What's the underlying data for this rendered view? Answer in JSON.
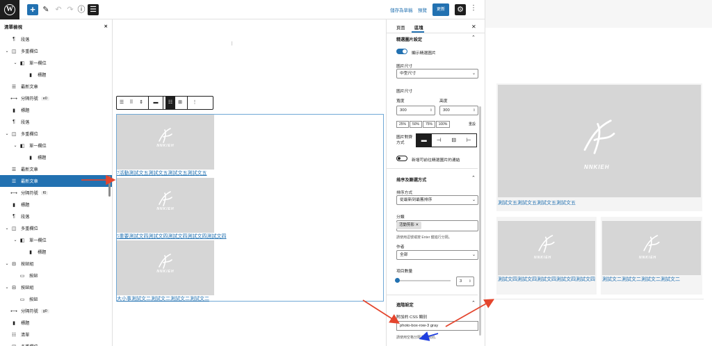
{
  "toolbar": {
    "save_draft_label": "儲存為草稿",
    "preview_label": "預覽",
    "update_label": "更新"
  },
  "listview": {
    "title": "清單檢視",
    "items": [
      {
        "label": "段落",
        "icon": "paragraph-icon",
        "glyph": "¶",
        "depth": 0,
        "chev": ""
      },
      {
        "label": "多重欄位",
        "icon": "columns-icon",
        "glyph": "◫",
        "depth": 0,
        "chev": "⌄"
      },
      {
        "label": "單一欄位",
        "icon": "column-icon",
        "glyph": "◧",
        "depth": 1,
        "chev": "⌄"
      },
      {
        "label": "標題",
        "icon": "bookmark-icon",
        "glyph": "▮",
        "depth": 2,
        "chev": ""
      },
      {
        "label": "最新文章",
        "icon": "post-list-icon",
        "glyph": "☰",
        "depth": 0,
        "chev": ""
      },
      {
        "label": "分隔符號",
        "icon": "separator-icon",
        "glyph": "⟷",
        "depth": 0,
        "chev": "",
        "badge": "e0"
      },
      {
        "label": "標題",
        "icon": "bookmark-icon",
        "glyph": "▮",
        "depth": 0,
        "chev": ""
      },
      {
        "label": "段落",
        "icon": "paragraph-icon",
        "glyph": "¶",
        "depth": 0,
        "chev": ""
      },
      {
        "label": "多重欄位",
        "icon": "columns-icon",
        "glyph": "◫",
        "depth": 0,
        "chev": "⌄"
      },
      {
        "label": "單一欄位",
        "icon": "column-icon",
        "glyph": "◧",
        "depth": 1,
        "chev": "⌄"
      },
      {
        "label": "標題",
        "icon": "bookmark-icon",
        "glyph": "▮",
        "depth": 2,
        "chev": ""
      },
      {
        "label": "最新文章",
        "icon": "post-list-icon",
        "glyph": "☰",
        "depth": 0,
        "chev": ""
      },
      {
        "label": "最新文章",
        "icon": "post-list-icon",
        "glyph": "☰",
        "depth": 0,
        "chev": "",
        "active": true
      },
      {
        "label": "分隔符號",
        "icon": "separator-icon",
        "glyph": "⟷",
        "depth": 0,
        "chev": "",
        "badge": "f0"
      },
      {
        "label": "標題",
        "icon": "bookmark-icon",
        "glyph": "▮",
        "depth": 0,
        "chev": ""
      },
      {
        "label": "段落",
        "icon": "paragraph-icon",
        "glyph": "¶",
        "depth": 0,
        "chev": ""
      },
      {
        "label": "多重欄位",
        "icon": "columns-icon",
        "glyph": "◫",
        "depth": 0,
        "chev": "⌄"
      },
      {
        "label": "單一欄位",
        "icon": "column-icon",
        "glyph": "◧",
        "depth": 1,
        "chev": "⌄"
      },
      {
        "label": "標題",
        "icon": "bookmark-icon",
        "glyph": "▮",
        "depth": 2,
        "chev": ""
      },
      {
        "label": "按鈕組",
        "icon": "buttons-icon",
        "glyph": "⊟",
        "depth": 0,
        "chev": "⌄"
      },
      {
        "label": "按鈕",
        "icon": "button-icon",
        "glyph": "▭",
        "depth": 1,
        "chev": ""
      },
      {
        "label": "按鈕組",
        "icon": "buttons-icon",
        "glyph": "⊟",
        "depth": 0,
        "chev": "⌄"
      },
      {
        "label": "按鈕",
        "icon": "button-icon",
        "glyph": "▭",
        "depth": 1,
        "chev": ""
      },
      {
        "label": "分隔符號",
        "icon": "separator-icon",
        "glyph": "⟷",
        "depth": 0,
        "chev": "",
        "badge": "g0"
      },
      {
        "label": "標題",
        "icon": "bookmark-icon",
        "glyph": "▮",
        "depth": 0,
        "chev": ""
      },
      {
        "label": "清單",
        "icon": "list-icon",
        "glyph": "☷",
        "depth": 0,
        "chev": ""
      },
      {
        "label": "多重欄位",
        "icon": "columns-icon",
        "glyph": "◫",
        "depth": 0,
        "chev": "⌄"
      }
    ]
  },
  "canvas": {
    "posts": [
      {
        "title": "7活動測試文五測試文五測試文五測試文五",
        "logo_text": "NNKIEH"
      },
      {
        "title": "5重要測試文四測試文四測試文四測試文四測試文四",
        "logo_text": "NNKIEH"
      },
      {
        "title": "大小事測試文二測試文二測試文二測試文二",
        "logo_text": "NNKIEH"
      }
    ]
  },
  "sidebar": {
    "tab_page": "頁面",
    "tab_block": "區塊",
    "featured_section": "精選圖片設定",
    "show_featured": "顯示精選圖片",
    "image_size_label": "圖片尺寸",
    "image_size_value": "中型尺寸",
    "image_dims_label": "圖片尺寸",
    "width_label": "寬度",
    "height_label": "高度",
    "width_value": "300",
    "height_value": "300",
    "pct": [
      "25%",
      "50%",
      "75%",
      "100%"
    ],
    "reset_label": "重設",
    "align_label": "圖片對齊方式",
    "link_label": "新增可前往精選圖片的連結",
    "sort_section": "排序及篩選方式",
    "order_label": "排序方式",
    "order_value": "從最新到最舊排序",
    "category_label": "分類",
    "category_tag": "活動剪影",
    "category_help": "請使用逗號或按 Enter 鍵進行分隔。",
    "author_label": "作者",
    "author_value": "全部",
    "count_label": "項目數量",
    "count_value": "3",
    "count_fraction": 0.0,
    "advanced_section": "進階設定",
    "css_label": "附加的 CSS 類別",
    "css_value": "photo-box-row-3 gray",
    "css_help": "請使用空格分隔多個類別。"
  },
  "preview": {
    "logo_text": "NNKIEH",
    "big_title": "測試文五測試文五測試文五測試文五",
    "card1_title": "測試文四測試文四測試文四測試文四測試文四",
    "card2_title": "測試文二測試文二測試文二測試文二"
  },
  "colors": {
    "accent": "#2271b1",
    "arrow_red": "#e4452d",
    "arrow_blue": "#1f3fe0",
    "thumb_gray": "#d6d6d6"
  }
}
